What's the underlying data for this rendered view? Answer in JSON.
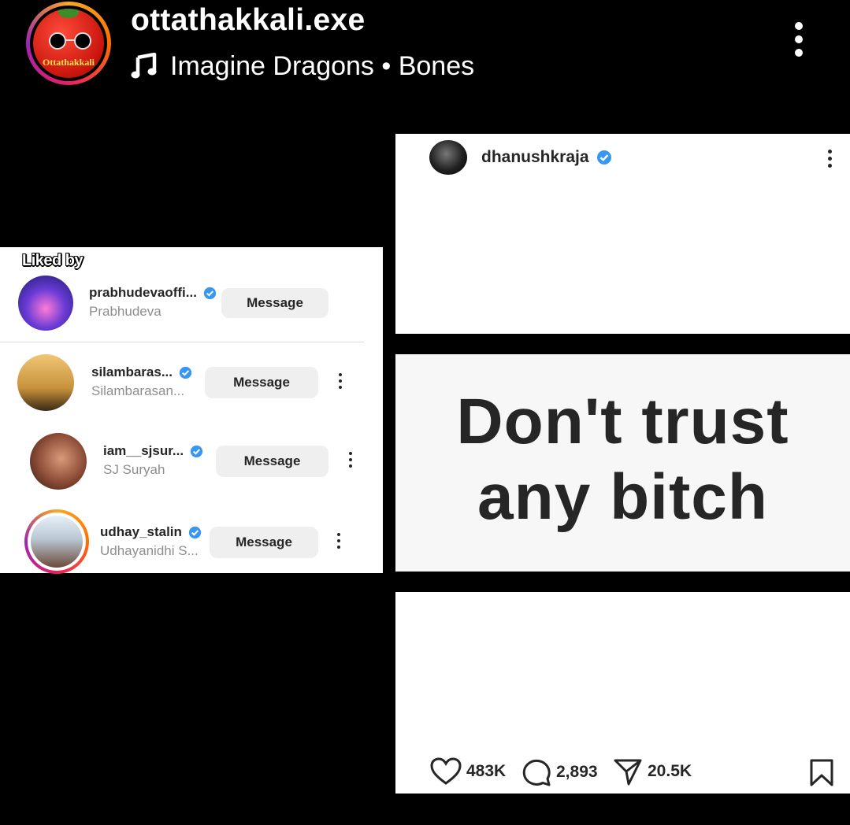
{
  "header": {
    "avatar_brand": "Ottathakkali",
    "account_name": "ottathakkali.exe",
    "music": "Imagine Dragons • Bones"
  },
  "liked_by": {
    "title": "Liked by",
    "users": [
      {
        "username": "prabhudevaoffi...",
        "full_name": "Prabhudeva",
        "button": "Message"
      },
      {
        "username": "silambaras...",
        "full_name": "Silambarasan...",
        "button": "Message"
      },
      {
        "username": "iam__sjsur...",
        "full_name": "SJ Suryah",
        "button": "Message"
      },
      {
        "username": "udhay_stalin",
        "full_name": "Udhayanidhi S...",
        "button": "Message"
      }
    ]
  },
  "post": {
    "username": "dhanushkraja",
    "quote_line1": "Don't trust",
    "quote_line2": "any bitch",
    "likes": "483K",
    "comments": "2,893",
    "shares": "20.5K"
  },
  "colors": {
    "verified": "#3897f0",
    "text_dark": "#262626",
    "text_muted": "#8e8e8e",
    "button_bg": "#efefef"
  }
}
